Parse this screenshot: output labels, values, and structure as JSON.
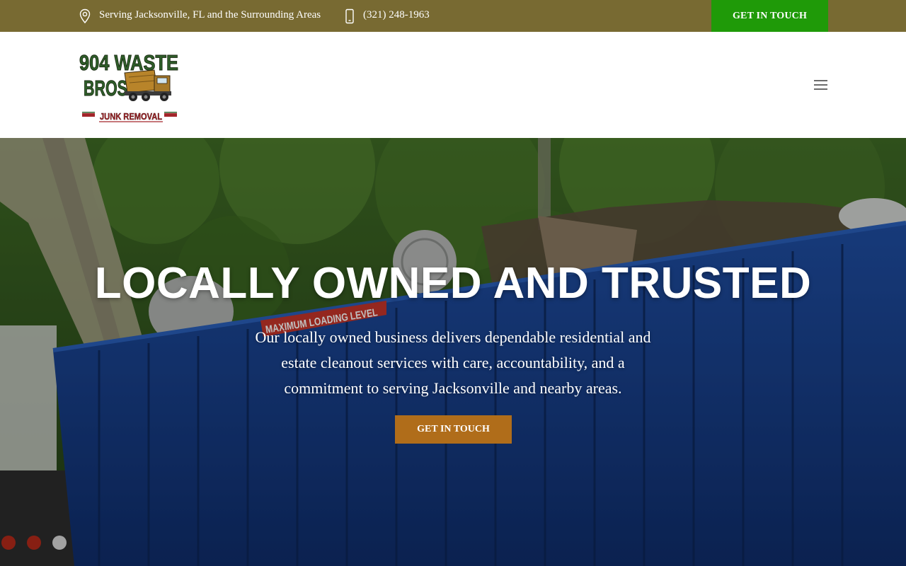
{
  "topbar": {
    "location_icon": "map-pin-icon",
    "location_text": "Serving Jacksonville, FL and the Surrounding Areas",
    "phone_icon": "mobile-phone-icon",
    "phone_text": "(321) 248-1963",
    "cta_label": "GET IN TOUCH",
    "background_color": "#786a32",
    "cta_color": "#1f9a08"
  },
  "header": {
    "logo": {
      "line1": "904 WASTE",
      "line2": "BROS",
      "tagline": "JUNK REMOVAL"
    },
    "menu_icon": "hamburger-menu-icon"
  },
  "hero": {
    "sign_text": "MAXIMUM LOADING LEVEL",
    "title": "LOCALLY OWNED AND TRUSTED",
    "subtitle": "Our locally owned business delivers dependable residential and estate cleanout services with care, accountability, and a commitment to serving Jacksonville and nearby areas.",
    "cta_label": "GET IN TOUCH",
    "cta_color": "#b06d1a"
  }
}
